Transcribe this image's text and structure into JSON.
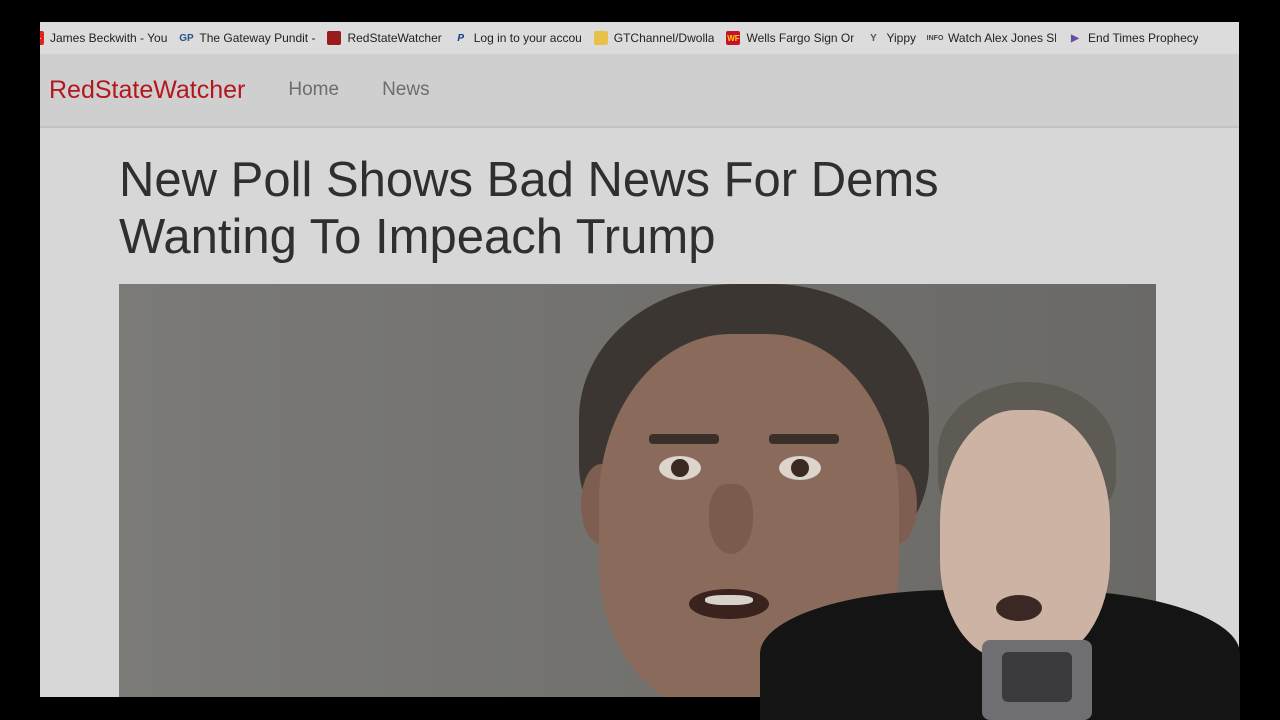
{
  "bookmarks": [
    {
      "label": "James Beckwith - You",
      "icon": "youtube-icon",
      "color": "#e62117"
    },
    {
      "label": "The Gateway Pundit -",
      "icon": "gp-icon",
      "color": "#2b4f8c"
    },
    {
      "label": "RedStateWatcher",
      "icon": "redstate-icon",
      "color": "#9a1b1b"
    },
    {
      "label": "Log in to your accour",
      "icon": "paypal-icon",
      "color": "#123c85"
    },
    {
      "label": "GTChannel/Dwolla",
      "icon": "folder-icon",
      "color": "#e8c248"
    },
    {
      "label": "Wells Fargo Sign On t",
      "icon": "wellsfargo-icon",
      "color": "#c8102e"
    },
    {
      "label": "Yippy",
      "icon": "yippy-icon",
      "color": "#555555"
    },
    {
      "label": "Watch Alex Jones Sho",
      "icon": "infowars-icon",
      "color": "#444444"
    },
    {
      "label": "End Times Prophecy I",
      "icon": "play-icon",
      "color": "#6b4aa8"
    }
  ],
  "site": {
    "brand": "RedStateWatcher",
    "nav": [
      "Home",
      "News"
    ]
  },
  "article": {
    "headline": "New Poll Shows Bad News For Dems Wanting To Impeach Trump"
  },
  "colors": {
    "brand": "#b3161e",
    "background": "#d7d7d7"
  }
}
